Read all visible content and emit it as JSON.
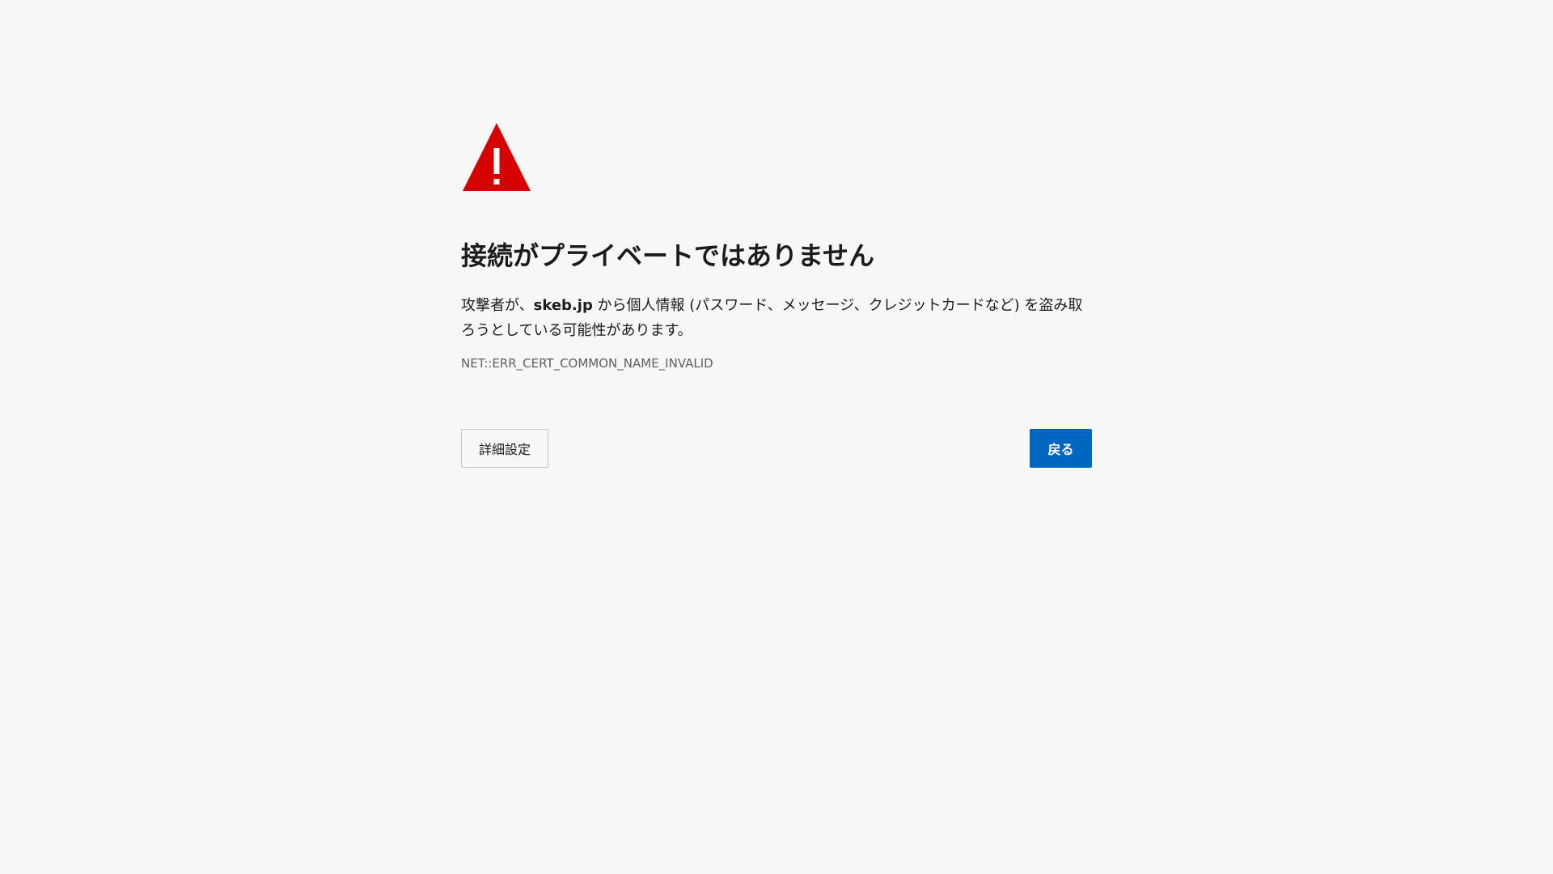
{
  "page": {
    "title": "接続がプライベートではありません",
    "message": {
      "prefix": "攻撃者が、",
      "domain": "skeb.jp",
      "suffix": " から個人情報 (パスワード、メッセージ、クレジットカードなど) を盗み取ろうとしている可能性があります。"
    },
    "error_code": "NET::ERR_CERT_COMMON_NAME_INVALID",
    "icon": "warning-triangle-icon",
    "colors": {
      "warning_red": "#d70000",
      "primary_button": "#0067c0",
      "background": "#f7f7f7"
    }
  },
  "buttons": {
    "advanced_label": "詳細設定",
    "back_label": "戻る"
  }
}
